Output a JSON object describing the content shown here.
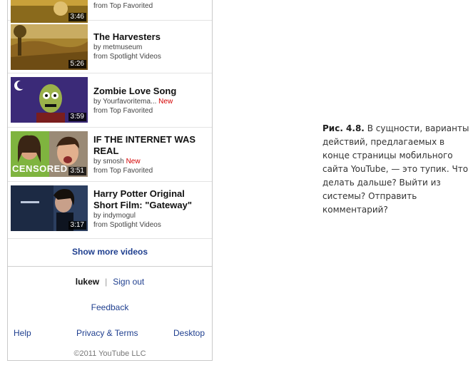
{
  "videos": [
    {
      "title": "",
      "by": "",
      "new": "",
      "from": "from Top Favorited",
      "duration": "3:46"
    },
    {
      "title": "The Harvesters",
      "by": "by metmuseum",
      "new": "",
      "from": "from Spotlight Videos",
      "duration": "5:26"
    },
    {
      "title": "Zombie Love Song",
      "by": "by Yourfavoritema...",
      "new": "New",
      "from": "from Top Favorited",
      "duration": "3:59"
    },
    {
      "title": "IF THE INTERNET WAS REAL",
      "by": "by smosh",
      "new": "New",
      "from": "from Top Favorited",
      "duration": "3:51",
      "badge": "CENSORED"
    },
    {
      "title": "Harry Potter Original Short Film: \"Gateway\"",
      "by": "by indymogul",
      "new": "",
      "from": "from Spotlight Videos",
      "duration": "3:17"
    }
  ],
  "show_more": "Show more videos",
  "footer": {
    "username": "lukew",
    "separator": "|",
    "sign_out": "Sign out",
    "feedback": "Feedback",
    "help": "Help",
    "privacy": "Privacy & Terms",
    "desktop": "Desktop",
    "copyright": "©2011 YouTube LLC"
  },
  "caption": {
    "label": "Рис. 4.8.",
    "text": "В сущности, варианты действий, предлагаемых в конце страницы мобильного сайта YouTube, — это тупик. Что делать дальше? Выйти из системы? Отправить комментарий?"
  }
}
